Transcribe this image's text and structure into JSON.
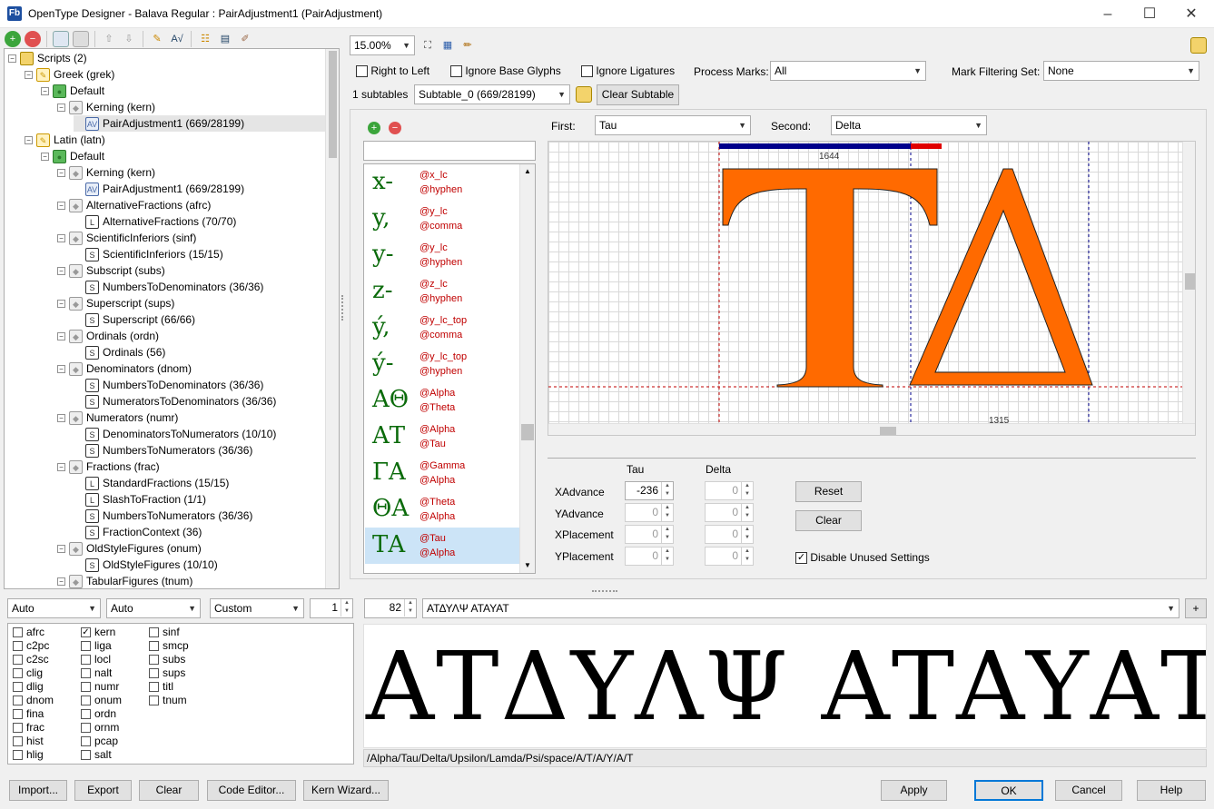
{
  "window": {
    "title": "OpenType Designer - Balava Regular : PairAdjustment1 (PairAdjustment)",
    "app_icon": "Fb",
    "minimize": "–",
    "maximize": "☐",
    "close": "✕"
  },
  "tree": {
    "rows": [
      {
        "label": "Scripts (2)",
        "icon": "folder-icon"
      },
      {
        "label": "Greek (grek)",
        "icon": "script-icon"
      },
      {
        "label": "Default",
        "icon": "language-globe-icon"
      },
      {
        "label": "Kerning (kern)",
        "icon": "feature-cube-icon"
      },
      {
        "label": "PairAdjustment1 (669/28199)",
        "icon": "pair-adjustment-icon"
      },
      {
        "label": "Latin (latn)",
        "icon": "script-icon"
      },
      {
        "label": "Default",
        "icon": "language-globe-icon"
      },
      {
        "label": "Kerning (kern)",
        "icon": "feature-cube-icon"
      },
      {
        "label": "PairAdjustment1 (669/28199)",
        "icon": "pair-adjustment-icon"
      },
      {
        "label": "AlternativeFractions (afrc)",
        "icon": "feature-cube-icon"
      },
      {
        "label": "AlternativeFractions (70/70)",
        "icon": "ligature-icon"
      },
      {
        "label": "ScientificInferiors (sinf)",
        "icon": "feature-cube-icon"
      },
      {
        "label": "ScientificInferiors (15/15)",
        "icon": "single-sub-icon"
      },
      {
        "label": "Subscript (subs)",
        "icon": "feature-cube-icon"
      },
      {
        "label": "NumbersToDenominators (36/36)",
        "icon": "single-sub-icon"
      },
      {
        "label": "Superscript (sups)",
        "icon": "feature-cube-icon"
      },
      {
        "label": "Superscript (66/66)",
        "icon": "single-sub-icon"
      },
      {
        "label": "Ordinals (ordn)",
        "icon": "feature-cube-icon"
      },
      {
        "label": "Ordinals (56)",
        "icon": "context-sub-icon"
      },
      {
        "label": "Denominators (dnom)",
        "icon": "feature-cube-icon"
      },
      {
        "label": "NumbersToDenominators (36/36)",
        "icon": "single-sub-icon"
      },
      {
        "label": "NumeratorsToDenominators (36/36)",
        "icon": "single-sub-icon"
      },
      {
        "label": "Numerators (numr)",
        "icon": "feature-cube-icon"
      },
      {
        "label": "DenominatorsToNumerators (10/10)",
        "icon": "single-sub-icon"
      },
      {
        "label": "NumbersToNumerators (36/36)",
        "icon": "single-sub-icon"
      },
      {
        "label": "Fractions (frac)",
        "icon": "feature-cube-icon"
      },
      {
        "label": "StandardFractions (15/15)",
        "icon": "ligature-icon"
      },
      {
        "label": "SlashToFraction (1/1)",
        "icon": "ligature-icon"
      },
      {
        "label": "NumbersToNumerators (36/36)",
        "icon": "single-sub-icon"
      },
      {
        "label": "FractionContext (36)",
        "icon": "context-sub-icon"
      },
      {
        "label": "OldStyleFigures (onum)",
        "icon": "feature-cube-icon"
      },
      {
        "label": "OldStyleFigures (10/10)",
        "icon": "single-sub-icon"
      },
      {
        "label": "TabularFigures (tnum)",
        "icon": "feature-cube-icon"
      }
    ]
  },
  "editor": {
    "zoom": "15.00%",
    "right_to_left": "Right to Left",
    "ignore_base": "Ignore Base Glyphs",
    "ignore_ligatures": "Ignore Ligatures",
    "process_marks_label": "Process Marks:",
    "process_marks_value": "All",
    "mark_filtering_label": "Mark Filtering Set:",
    "mark_filtering_value": "None",
    "subtables_count": "1 subtables",
    "subtable_value": "Subtable_0 (669/28199)",
    "clear_subtable": "Clear Subtable",
    "first_label": "First:",
    "first_value": "Tau",
    "second_label": "Second:",
    "second_value": "Delta",
    "first_glyph": "T",
    "second_glyph": "Δ",
    "first_advance": "1644",
    "second_advance": "1315"
  },
  "pairs": [
    {
      "glyphs": "x-",
      "c1": "@x_lc",
      "c2": "@hyphen"
    },
    {
      "glyphs": "y,",
      "c1": "@y_lc",
      "c2": "@comma"
    },
    {
      "glyphs": "y-",
      "c1": "@y_lc",
      "c2": "@hyphen"
    },
    {
      "glyphs": "z-",
      "c1": "@z_lc",
      "c2": "@hyphen"
    },
    {
      "glyphs": "ý,",
      "c1": "@y_lc_top",
      "c2": "@comma"
    },
    {
      "glyphs": "ý-",
      "c1": "@y_lc_top",
      "c2": "@hyphen"
    },
    {
      "glyphs": "ΑΘ",
      "c1": "@Alpha",
      "c2": "@Theta"
    },
    {
      "glyphs": "ΑΤ",
      "c1": "@Alpha",
      "c2": "@Tau"
    },
    {
      "glyphs": "ΓΑ",
      "c1": "@Gamma",
      "c2": "@Alpha"
    },
    {
      "glyphs": "ΘΑ",
      "c1": "@Theta",
      "c2": "@Alpha"
    },
    {
      "glyphs": "ΤΑ",
      "c1": "@Tau",
      "c2": "@Alpha"
    }
  ],
  "adjust": {
    "col1": "Tau",
    "col2": "Delta",
    "xadvance": "XAdvance",
    "yadvance": "YAdvance",
    "xplacement": "XPlacement",
    "yplacement": "YPlacement",
    "tau_xadv": "-236",
    "zero": "0",
    "reset": "Reset",
    "clear": "Clear",
    "disable_unused": "Disable Unused Settings"
  },
  "bottom": {
    "combo1": "Auto",
    "combo2": "Auto",
    "combo3": "Custom",
    "spin_value": "1",
    "size_value": "82",
    "preview_input": "ΑΤΔΥΛΨ ΑΤΑΥΑΤ",
    "plus": "+",
    "preview_text": "ΑΤΔΥΛΨ ΑΤΑΥΑΤ",
    "glyph_sequence": "/Alpha/Tau/Delta/Upsilon/Lamda/Psi/space/A/T/A/Y/A/T",
    "features": [
      [
        "afrc",
        "c2pc",
        "c2sc",
        "clig",
        "dlig",
        "dnom",
        "fina",
        "frac",
        "hist",
        "hlig"
      ],
      [
        "kern",
        "liga",
        "locl",
        "nalt",
        "numr",
        "onum",
        "ordn",
        "ornm",
        "pcap",
        "salt"
      ],
      [
        "sinf",
        "smcp",
        "subs",
        "sups",
        "titl",
        "tnum"
      ]
    ],
    "checked": [
      "kern"
    ]
  },
  "footer": {
    "import": "Import...",
    "export": "Export",
    "clear": "Clear",
    "code_editor": "Code Editor...",
    "kern_wizard": "Kern Wizard...",
    "apply": "Apply",
    "ok": "OK",
    "cancel": "Cancel",
    "help": "Help"
  },
  "colors": {
    "glyph_fill": "#ff6a00",
    "advance_bar": "#00008b",
    "kern_bar": "#e00000",
    "pair_glyph": "#0b6b0b",
    "class_text": "#c00000",
    "selection": "#cce4f7"
  }
}
